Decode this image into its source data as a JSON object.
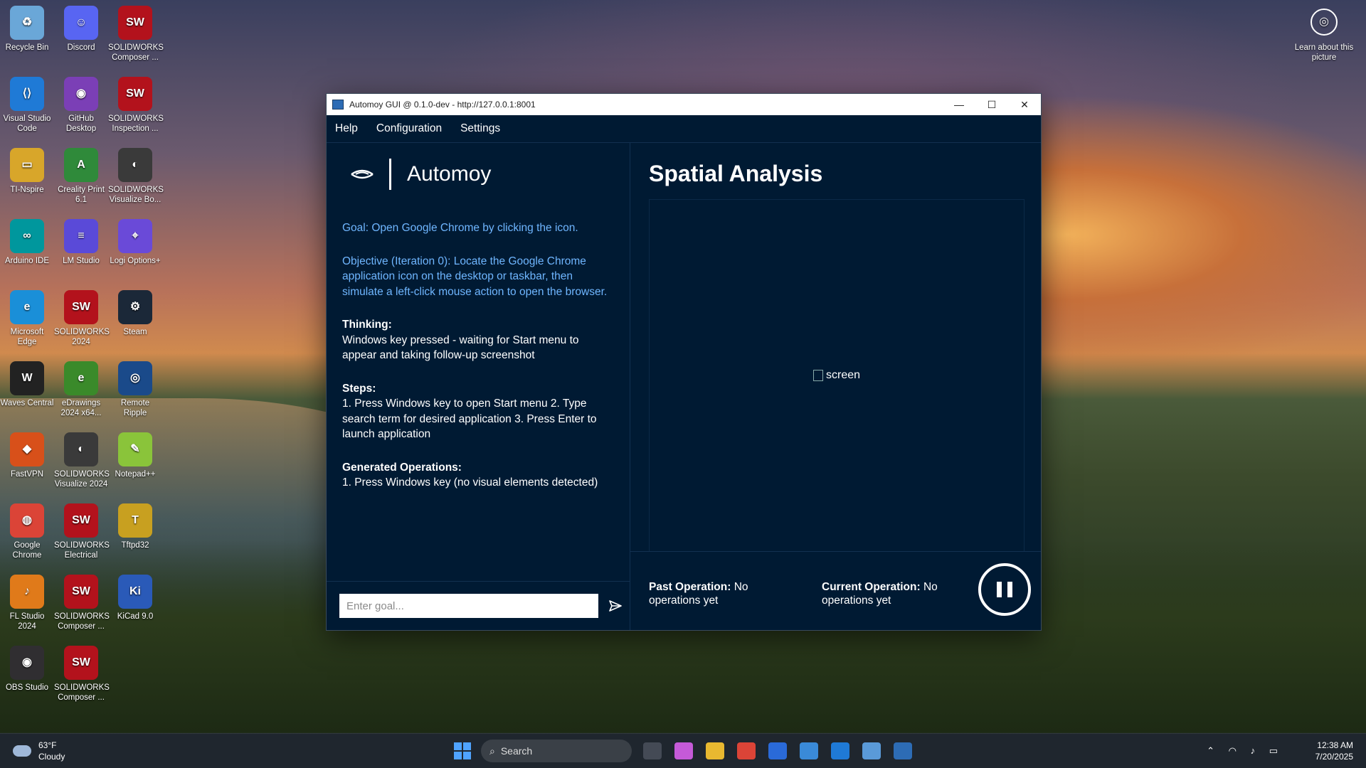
{
  "desktop": {
    "icons": [
      {
        "label": "Recycle Bin",
        "color": "#6aa7d8",
        "glyph": "♻"
      },
      {
        "label": "Discord",
        "color": "#5865f2",
        "glyph": "☺"
      },
      {
        "label": "SOLIDWORKS Composer ...",
        "color": "#b3121c",
        "glyph": "SW"
      },
      {
        "label": "Visual Studio Code",
        "color": "#1f7ad6",
        "glyph": "⟨⟩"
      },
      {
        "label": "GitHub Desktop",
        "color": "#7b3fb6",
        "glyph": "◉"
      },
      {
        "label": "SOLIDWORKS Inspection ...",
        "color": "#b3121c",
        "glyph": "SW"
      },
      {
        "label": "TI-Nspire",
        "color": "#d8a62a",
        "glyph": "▭"
      },
      {
        "label": "Creality Print 6.1",
        "color": "#2f8a3a",
        "glyph": "A"
      },
      {
        "label": "SOLIDWORKS Visualize Bo...",
        "color": "#3a3a3a",
        "glyph": "◐"
      },
      {
        "label": "Arduino IDE",
        "color": "#00979d",
        "glyph": "∞"
      },
      {
        "label": "LM Studio",
        "color": "#5a4ad8",
        "glyph": "≡"
      },
      {
        "label": "Logi Options+",
        "color": "#6a4ad8",
        "glyph": "⌖"
      },
      {
        "label": "Microsoft Edge",
        "color": "#1a8fd8",
        "glyph": "e"
      },
      {
        "label": "SOLIDWORKS 2024",
        "color": "#b3121c",
        "glyph": "SW"
      },
      {
        "label": "Steam",
        "color": "#1b2838",
        "glyph": "⚙"
      },
      {
        "label": "Waves Central",
        "color": "#222222",
        "glyph": "W"
      },
      {
        "label": "eDrawings 2024 x64...",
        "color": "#3a8a2a",
        "glyph": "e"
      },
      {
        "label": "Remote Ripple",
        "color": "#1a4a8a",
        "glyph": "◎"
      },
      {
        "label": "FastVPN",
        "color": "#d8501a",
        "glyph": "◆"
      },
      {
        "label": "SOLIDWORKS Visualize 2024",
        "color": "#3a3a3a",
        "glyph": "◐"
      },
      {
        "label": "Notepad++",
        "color": "#8ac43a",
        "glyph": "✎"
      },
      {
        "label": "Google Chrome",
        "color": "#db4437",
        "glyph": "◍"
      },
      {
        "label": "SOLIDWORKS Electrical",
        "color": "#b3121c",
        "glyph": "SW"
      },
      {
        "label": "Tftpd32",
        "color": "#c8a020",
        "glyph": "T"
      },
      {
        "label": "FL Studio 2024",
        "color": "#e07a1a",
        "glyph": "♪"
      },
      {
        "label": "SOLIDWORKS Composer ...",
        "color": "#b3121c",
        "glyph": "SW"
      },
      {
        "label": "KiCad 9.0",
        "color": "#2a5ab8",
        "glyph": "Ki"
      },
      {
        "label": "OBS Studio",
        "color": "#302e31",
        "glyph": "◉"
      },
      {
        "label": "SOLIDWORKS Composer ...",
        "color": "#b3121c",
        "glyph": "SW"
      }
    ],
    "learn_label": "Learn about this picture"
  },
  "window": {
    "title": "Automoy GUI @ 0.1.0-dev - http://127.0.0.1:8001",
    "minimize": "—",
    "maximize": "☐",
    "close": "✕"
  },
  "menu": {
    "help": "Help",
    "configuration": "Configuration",
    "settings": "Settings"
  },
  "brand": {
    "name": "Automoy"
  },
  "left": {
    "goal": "Goal: Open Google Chrome by clicking the icon.",
    "objective": "Objective (Iteration 0): Locate the Google Chrome application icon on the desktop or taskbar, then simulate a left-click mouse action to open the browser.",
    "thinking_head": "Thinking:",
    "thinking": "Windows key pressed - waiting for Start menu to appear and taking follow-up screenshot",
    "steps_head": "Steps:",
    "steps": "1. Press Windows key to open Start menu 2. Type search term for desired application 3. Press Enter to launch application",
    "ops_head": "Generated Operations:",
    "ops": "1. Press Windows key (no visual elements detected)",
    "goal_placeholder": "Enter goal..."
  },
  "right": {
    "title": "Spatial Analysis",
    "screen_alt": "screen",
    "past_head": "Past Operation:",
    "past_value": " No operations yet",
    "current_head": "Current Operation:",
    "current_value": " No operations yet"
  },
  "taskbar": {
    "temp": "63°F",
    "condition": "Cloudy",
    "search_label": "Search",
    "time": "12:38 AM",
    "date": "7/20/2025",
    "tray": "⌃ ◠ ♪ ▭",
    "apps": [
      {
        "name": "task-view",
        "color": "#444a55"
      },
      {
        "name": "copilot",
        "color": "#c55ad8"
      },
      {
        "name": "file-explorer",
        "color": "#e8b830"
      },
      {
        "name": "chrome",
        "color": "#db4437"
      },
      {
        "name": "store",
        "color": "#2a6ad8"
      },
      {
        "name": "photos",
        "color": "#3a8ad8"
      },
      {
        "name": "vscode",
        "color": "#1f7ad6"
      },
      {
        "name": "notepad",
        "color": "#5a9ad8"
      },
      {
        "name": "automoy",
        "color": "#2d6cb5"
      }
    ]
  }
}
